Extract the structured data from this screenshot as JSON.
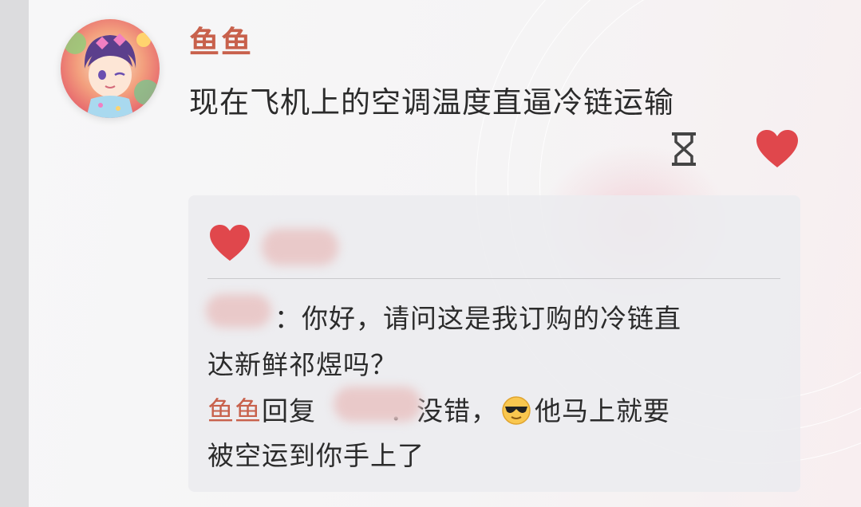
{
  "post": {
    "author": "鱼鱼",
    "text": "现在飞机上的空调温度直逼冷链运输"
  },
  "comments": [
    {
      "name_obscured": true,
      "line1": "：你好，请问这是我订购的冷链直",
      "line2": "达新鲜祁煜吗？"
    }
  ],
  "reply": {
    "author": "鱼鱼",
    "verb": "回复",
    "text_a": "：没错，",
    "text_b": "他马上就要",
    "line2": "被空运到你手上了"
  },
  "icons": {
    "hourglass": "hourglass-icon",
    "like": "heart-icon",
    "emoji": "sunglasses-emoji-icon"
  },
  "colors": {
    "accent": "#c8614c",
    "heart": "#e0474c"
  }
}
